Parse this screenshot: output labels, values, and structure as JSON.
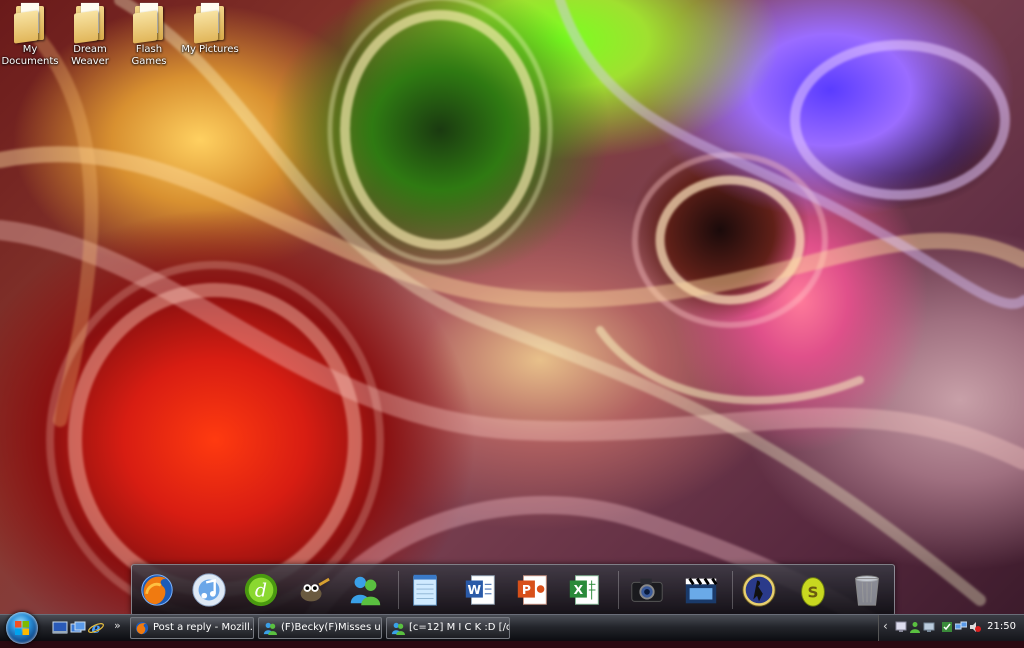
{
  "desktop": {
    "icons": [
      {
        "label": "My Documents",
        "icon": "folder-icon"
      },
      {
        "label": "Dream Weaver",
        "icon": "folder-icon"
      },
      {
        "label": "Flash Games",
        "icon": "folder-icon"
      },
      {
        "label": "My Pictures",
        "icon": "folder-icon"
      }
    ]
  },
  "dock": {
    "items": [
      {
        "icon": "firefox-icon"
      },
      {
        "icon": "itunes-icon"
      },
      {
        "icon": "dreamweaver-icon"
      },
      {
        "icon": "gimp-icon"
      },
      {
        "icon": "messenger-icon"
      },
      {
        "icon": "notepad-icon"
      },
      {
        "icon": "word-icon"
      },
      {
        "icon": "powerpoint-icon"
      },
      {
        "icon": "excel-icon"
      },
      {
        "icon": "camera-icon"
      },
      {
        "icon": "movie-maker-icon"
      },
      {
        "icon": "counter-strike-icon"
      },
      {
        "icon": "steam-egg-icon"
      },
      {
        "icon": "recycle-bin-icon"
      }
    ]
  },
  "taskbar": {
    "quick_launch": [
      {
        "icon": "show-desktop-icon"
      },
      {
        "icon": "switch-windows-icon"
      },
      {
        "icon": "internet-explorer-icon"
      }
    ],
    "overflow_glyph": "»",
    "tasks": [
      {
        "label": "Post a reply - Mozill...",
        "icon": "firefox-icon"
      },
      {
        "label": "(F)Becky(F)Misses u ...",
        "icon": "messenger-icon"
      },
      {
        "label": "[c=12] M I C K :D [/c...",
        "icon": "messenger-icon"
      }
    ],
    "tray": {
      "clock": "21:50",
      "expand_glyph": "‹"
    }
  },
  "colors": {
    "taskbar_top": "#4a4d55",
    "taskbar_bottom": "#0b0c10",
    "start_orb": "#2a8fd8"
  }
}
